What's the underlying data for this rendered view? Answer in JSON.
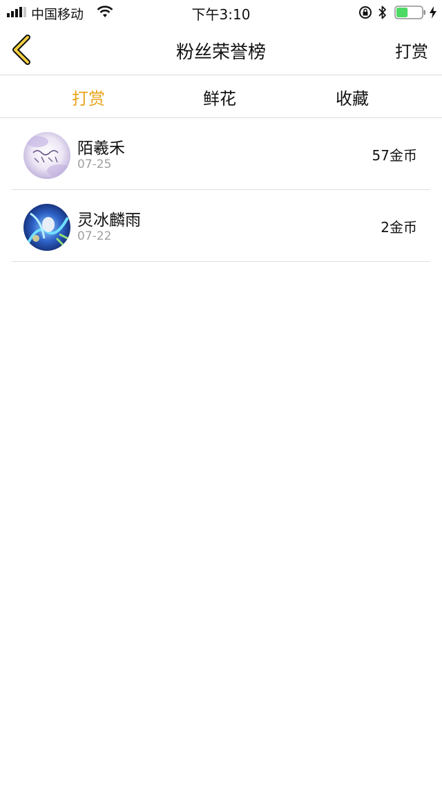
{
  "status_bar": {
    "carrier": "中国移动",
    "time": "下午3:10",
    "battery_level": 0.45,
    "battery_color": "#4cd964"
  },
  "nav": {
    "title": "粉丝荣誉榜",
    "action_label": "打赏",
    "back_icon": "chevron-left-icon",
    "accent_color": "#e8a317"
  },
  "tabs": [
    {
      "label": "打赏",
      "active": true
    },
    {
      "label": "鲜花",
      "active": false
    },
    {
      "label": "收藏",
      "active": false
    }
  ],
  "list": [
    {
      "name": "陌羲禾",
      "date": "07-25",
      "amount": "57金币"
    },
    {
      "name": "灵冰麟雨",
      "date": "07-22",
      "amount": "2金币"
    }
  ]
}
